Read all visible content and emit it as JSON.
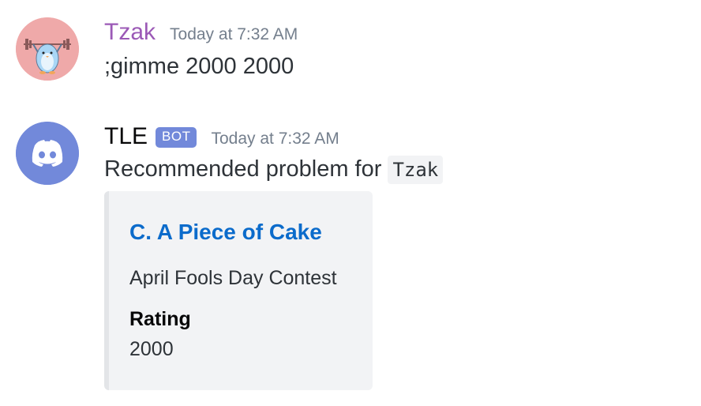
{
  "messages": [
    {
      "author": "Tzak",
      "author_color": "#9b59b6",
      "timestamp": "Today at 7:32 AM",
      "content": ";gimme 2000 2000",
      "avatar_icon": "weightlifting-penguin-avatar"
    },
    {
      "author": "TLE",
      "bot_tag": "BOT",
      "timestamp": "Today at 7:32 AM",
      "content_prefix": "Recommended problem for ",
      "content_code": "Tzak",
      "avatar_icon": "discord-logo-icon",
      "embed": {
        "title": "C. A Piece of Cake",
        "description": "April Fools Day Contest",
        "fields": [
          {
            "name": "Rating",
            "value": "2000"
          }
        ]
      }
    }
  ],
  "colors": {
    "bot_tag_bg": "#7289da",
    "link": "#0b6bcb",
    "embed_bg": "#f2f3f5",
    "timestamp": "#747f8d"
  }
}
